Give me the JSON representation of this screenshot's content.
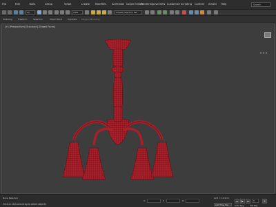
{
  "menu": {
    "items": [
      "File",
      "Edit",
      "Tools",
      "Group",
      "Views",
      "Create",
      "Modifiers",
      "Animation",
      "Graph Editors",
      "Rendering",
      "Civil View",
      "Customize",
      "Scripting",
      "Content",
      "Arnold",
      "Help"
    ],
    "search_text": "Search"
  },
  "toolbar": {
    "filter_value": "All",
    "view_value": "View",
    "named_selection_placeholder": "Create Selection Set"
  },
  "ribbon": {
    "tabs": [
      "Modeling",
      "Freeform",
      "Selection",
      "Object Paint",
      "Populate"
    ],
    "sub_label": "Polygon Modeling"
  },
  "viewport": {
    "label": "[+] [Perspective] [Standard] [Edged Faces]",
    "model_color": "#a8202a",
    "wire_color": "#5a0a10"
  },
  "statusbar": {
    "message": "Click or click-and-drag to select objects",
    "selection": "None Selected",
    "grid": "Grid = 10,0cm",
    "x_label": "X:",
    "y_label": "Y:",
    "z_label": "Z:",
    "add_time_tag": "Add Time Tag",
    "auto_key": "Auto Key",
    "set_key": "Set Key",
    "frame": "0"
  },
  "colors": {
    "accent": "#4a90d9"
  }
}
